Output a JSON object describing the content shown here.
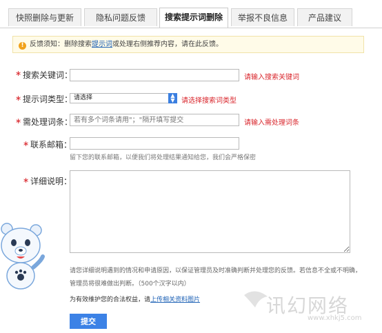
{
  "tabs": [
    {
      "label": "快照删除与更新",
      "active": false
    },
    {
      "label": "隐私问题反馈",
      "active": false
    },
    {
      "label": "搜索提示词删除",
      "active": true
    },
    {
      "label": "举报不良信息",
      "active": false
    },
    {
      "label": "产品建议",
      "active": false
    }
  ],
  "notice": {
    "prefix": "反馈须知：删除搜索",
    "link": "提示词",
    "suffix": "或处理右侧推荐内容，请在此反馈。"
  },
  "form": {
    "keyword": {
      "label": "搜索关键词：",
      "value": "",
      "error": "请输入搜索关键词"
    },
    "type": {
      "label": "提示词类型：",
      "selected": "请选择",
      "error": "请选择搜索词类型"
    },
    "words": {
      "label": "需处理词条：",
      "placeholder": "若有多个词条请用\"；\"隔开填写提交",
      "error": "请输入需处理词条"
    },
    "email": {
      "label": "联系邮箱：",
      "hint": "留下您的联系邮箱，以便我们将处理结果通知给您，我们会严格保密"
    },
    "detail": {
      "label": "详细说明："
    }
  },
  "detail_note": "请您详细说明遇到的情况和申请原因，以保证管理员及时准确判断并处理您的反馈。若信息不全或不明确，管理员将很难做出判断。（500个汉字以内）",
  "upload": {
    "prefix": "为有效维护您的合法权益，请",
    "link": "上传相关资料图片"
  },
  "submit_label": "提交",
  "watermark": {
    "text": "讯幻网络",
    "url": "www.xhkj5.com"
  },
  "colors": {
    "accent": "#3c82e6",
    "error": "#d9262c",
    "link": "#1a5fb4"
  }
}
